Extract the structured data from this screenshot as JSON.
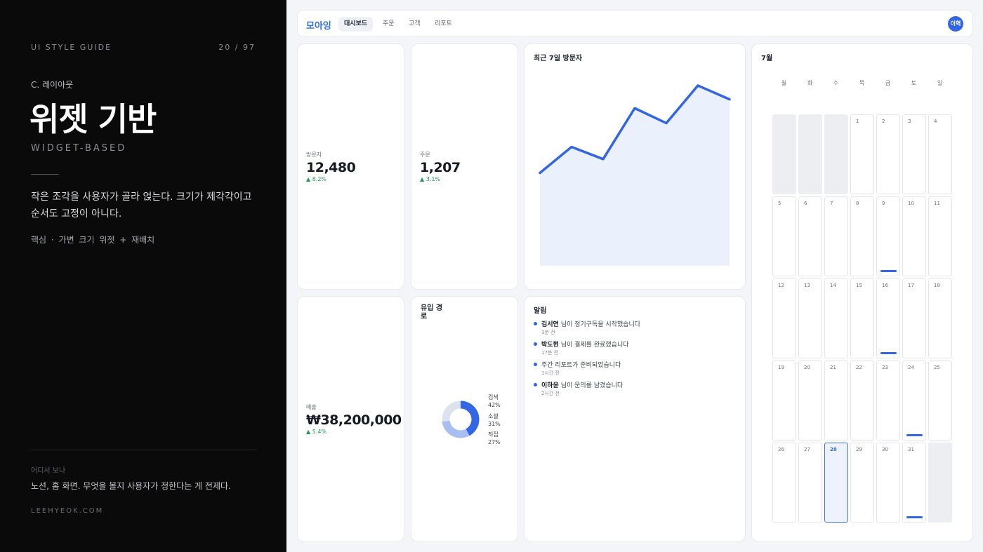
{
  "guide": {
    "label": "UI STYLE GUIDE",
    "page": "20 / 97",
    "section": "C. 레이아웃",
    "title": "위젯 기반",
    "subtitle": "WIDGET-BASED",
    "description": "작은 조각을 사용자가 골라 얹는다. 크기가 제각각이고 순서도 고정이 아니다.",
    "core": "핵심 · 가변 크기 위젯 + 재배치",
    "where_label": "어디서 보나",
    "where_text": "노션, 홈 화면. 무엇을 볼지 사용자가 정한다는 게 전제다.",
    "site": "LEEHYEOK.COM"
  },
  "app": {
    "logo": "모아잉",
    "tabs": [
      {
        "label": "대시보드",
        "active": true
      },
      {
        "label": "주문",
        "active": false
      },
      {
        "label": "고객",
        "active": false
      },
      {
        "label": "리포트",
        "active": false
      }
    ],
    "avatar": "이혁"
  },
  "stats": {
    "visitors": {
      "label": "방문자",
      "value": "12,480",
      "delta": "▲ 8.2%"
    },
    "orders": {
      "label": "주문",
      "value": "1,207",
      "delta": "▲ 3.1%"
    },
    "sales": {
      "label": "매출",
      "value": "₩38,200,000",
      "delta": "▲ 5.4%"
    }
  },
  "visitors_chart": {
    "title": "최근 7일 방문자",
    "line_color": "#3266e3",
    "fill_color": "#eaf0fc"
  },
  "chart_data": {
    "type": "area",
    "title": "최근 7일 방문자",
    "x": [
      1,
      2,
      3,
      4,
      5,
      6,
      7
    ],
    "values": [
      1680,
      2150,
      1930,
      2850,
      2580,
      3260,
      3010
    ],
    "ylim": [
      0,
      3500
    ],
    "grid": false
  },
  "sources": {
    "title": "유입 경로",
    "items": [
      {
        "name": "검색",
        "pct": "42%",
        "value": 42,
        "color": "#3266e3"
      },
      {
        "name": "소셜",
        "pct": "31%",
        "value": 31,
        "color": "#a9bef0"
      },
      {
        "name": "직접",
        "pct": "27%",
        "value": 27,
        "color": "#dde3ec"
      }
    ]
  },
  "notifications": {
    "title": "알림",
    "items": [
      {
        "name": "김서연",
        "msg": " 님이 정기구독을 시작했습니다",
        "time": "3분 전"
      },
      {
        "name": "박도현",
        "msg": " 님이 결제를 완료했습니다",
        "time": "17분 전"
      },
      {
        "name": "",
        "msg": "주간 리포트가 준비되었습니다",
        "time": "1시간 전"
      },
      {
        "name": "이하윤",
        "msg": " 님이 문의를 남겼습니다",
        "time": "2시간 전"
      }
    ]
  },
  "calendar": {
    "title": "7월",
    "weekdays": [
      "월",
      "화",
      "수",
      "목",
      "금",
      "토",
      "일"
    ],
    "days": [
      "",
      "",
      "",
      "1",
      "2",
      "3",
      "4",
      "5",
      "6",
      "7",
      "8",
      "9",
      "10",
      "11",
      "12",
      "13",
      "14",
      "15",
      "16",
      "17",
      "18",
      "19",
      "20",
      "21",
      "22",
      "23",
      "24",
      "25",
      "26",
      "27",
      "28",
      "29",
      "30",
      "31",
      ""
    ],
    "today": "28",
    "event_days": [
      "9",
      "16",
      "24",
      "31"
    ]
  }
}
